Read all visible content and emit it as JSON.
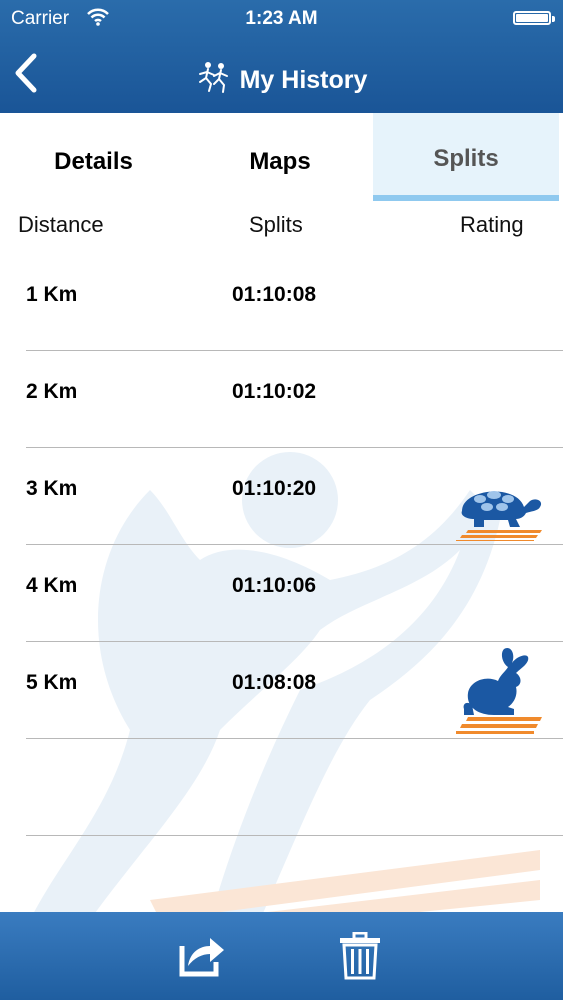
{
  "status_bar": {
    "carrier": "Carrier",
    "time": "1:23 AM"
  },
  "nav": {
    "title": "My History"
  },
  "tabs": [
    {
      "label": "Details",
      "active": false
    },
    {
      "label": "Maps",
      "active": false
    },
    {
      "label": "Splits",
      "active": true
    }
  ],
  "table": {
    "headers": {
      "distance": "Distance",
      "splits": "Splits",
      "rating": "Rating"
    },
    "rows": [
      {
        "distance": "1 Km",
        "split": "01:10:08",
        "rating": ""
      },
      {
        "distance": "2 Km",
        "split": "01:10:02",
        "rating": ""
      },
      {
        "distance": "3 Km",
        "split": "01:10:20",
        "rating": "turtle-icon"
      },
      {
        "distance": "4 Km",
        "split": "01:10:06",
        "rating": ""
      },
      {
        "distance": "5 Km",
        "split": "01:08:08",
        "rating": "rabbit-icon"
      },
      {
        "distance": "",
        "split": "",
        "rating": ""
      }
    ]
  },
  "colors": {
    "header": "#1f5fa2",
    "active_tab_bg": "#e6f3fb",
    "active_tab_indicator": "#8fc9ef",
    "rating_icon": "#1b58a3",
    "rating_stripes": "#f08a2c"
  },
  "toolbar": {
    "icons": [
      "share-icon",
      "trash-icon"
    ]
  }
}
